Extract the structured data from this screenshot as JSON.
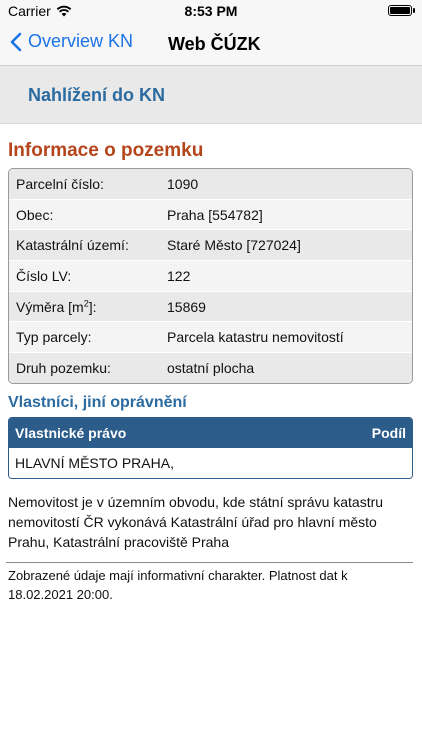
{
  "status_bar": {
    "carrier": "Carrier",
    "time": "8:53 PM",
    "wifi_icon": "wifi-icon",
    "battery_icon": "battery-icon"
  },
  "nav": {
    "back_label": "Overview KN",
    "title": "Web ČÚZK",
    "back_icon": "chevron-left-icon"
  },
  "portal": {
    "title": "Nahlížení do KN"
  },
  "parcel_info": {
    "heading": "Informace o pozemku",
    "rows": [
      {
        "label": "Parcelní číslo:",
        "value": "1090"
      },
      {
        "label": "Obec:",
        "value": "Praha [554782]"
      },
      {
        "label": "Katastrální území:",
        "value": "Staré Město [727024]"
      },
      {
        "label": "Číslo LV:",
        "value": "122"
      },
      {
        "label_main": "Výměra [m",
        "label_sup": "2",
        "label_end": "]:",
        "value": "15869"
      },
      {
        "label": "Typ parcely:",
        "value": "Parcela katastru nemovitostí"
      },
      {
        "label": "Druh pozemku:",
        "value": "ostatní plocha"
      }
    ]
  },
  "owners": {
    "heading": "Vlastníci, jiní oprávnění",
    "col_right": "Vlastnické právo",
    "col_share": "Podíl",
    "rows": [
      {
        "name": "HLAVNÍ MĚSTO PRAHA,"
      }
    ]
  },
  "notice": "Nemovitost je v územním obvodu, kde státní správu katastru nemovitostí ČR vykonává Katastrální úřad pro hlavní město Prahu, Katastrální pracoviště Praha",
  "disclaimer": "Zobrazené údaje mají informativní charakter. Platnost dat k 18.02.2021 20:00.",
  "colors": {
    "accent_blue": "#1a73e8",
    "heading_blue": "#2b6ba0",
    "heading_orange": "#b5451b",
    "table_header_blue": "#2b5c8a"
  }
}
